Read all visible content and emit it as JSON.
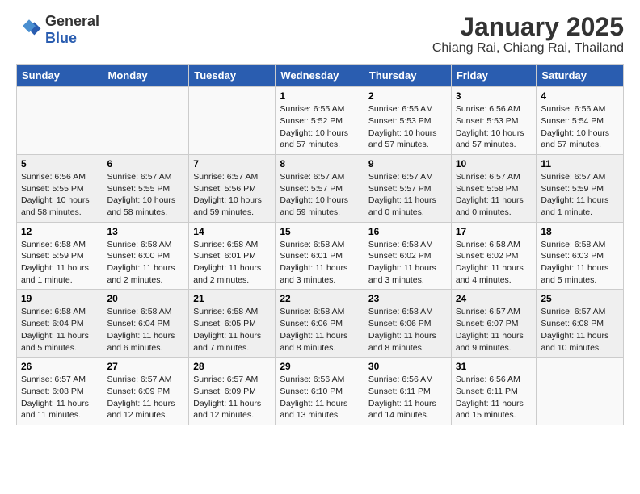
{
  "header": {
    "logo_general": "General",
    "logo_blue": "Blue",
    "title": "January 2025",
    "subtitle": "Chiang Rai, Chiang Rai, Thailand"
  },
  "weekdays": [
    "Sunday",
    "Monday",
    "Tuesday",
    "Wednesday",
    "Thursday",
    "Friday",
    "Saturday"
  ],
  "weeks": [
    [
      {
        "day": "",
        "info": ""
      },
      {
        "day": "",
        "info": ""
      },
      {
        "day": "",
        "info": ""
      },
      {
        "day": "1",
        "info": "Sunrise: 6:55 AM\nSunset: 5:52 PM\nDaylight: 10 hours\nand 57 minutes."
      },
      {
        "day": "2",
        "info": "Sunrise: 6:55 AM\nSunset: 5:53 PM\nDaylight: 10 hours\nand 57 minutes."
      },
      {
        "day": "3",
        "info": "Sunrise: 6:56 AM\nSunset: 5:53 PM\nDaylight: 10 hours\nand 57 minutes."
      },
      {
        "day": "4",
        "info": "Sunrise: 6:56 AM\nSunset: 5:54 PM\nDaylight: 10 hours\nand 57 minutes."
      }
    ],
    [
      {
        "day": "5",
        "info": "Sunrise: 6:56 AM\nSunset: 5:55 PM\nDaylight: 10 hours\nand 58 minutes."
      },
      {
        "day": "6",
        "info": "Sunrise: 6:57 AM\nSunset: 5:55 PM\nDaylight: 10 hours\nand 58 minutes."
      },
      {
        "day": "7",
        "info": "Sunrise: 6:57 AM\nSunset: 5:56 PM\nDaylight: 10 hours\nand 59 minutes."
      },
      {
        "day": "8",
        "info": "Sunrise: 6:57 AM\nSunset: 5:57 PM\nDaylight: 10 hours\nand 59 minutes."
      },
      {
        "day": "9",
        "info": "Sunrise: 6:57 AM\nSunset: 5:57 PM\nDaylight: 11 hours\nand 0 minutes."
      },
      {
        "day": "10",
        "info": "Sunrise: 6:57 AM\nSunset: 5:58 PM\nDaylight: 11 hours\nand 0 minutes."
      },
      {
        "day": "11",
        "info": "Sunrise: 6:57 AM\nSunset: 5:59 PM\nDaylight: 11 hours\nand 1 minute."
      }
    ],
    [
      {
        "day": "12",
        "info": "Sunrise: 6:58 AM\nSunset: 5:59 PM\nDaylight: 11 hours\nand 1 minute."
      },
      {
        "day": "13",
        "info": "Sunrise: 6:58 AM\nSunset: 6:00 PM\nDaylight: 11 hours\nand 2 minutes."
      },
      {
        "day": "14",
        "info": "Sunrise: 6:58 AM\nSunset: 6:01 PM\nDaylight: 11 hours\nand 2 minutes."
      },
      {
        "day": "15",
        "info": "Sunrise: 6:58 AM\nSunset: 6:01 PM\nDaylight: 11 hours\nand 3 minutes."
      },
      {
        "day": "16",
        "info": "Sunrise: 6:58 AM\nSunset: 6:02 PM\nDaylight: 11 hours\nand 3 minutes."
      },
      {
        "day": "17",
        "info": "Sunrise: 6:58 AM\nSunset: 6:02 PM\nDaylight: 11 hours\nand 4 minutes."
      },
      {
        "day": "18",
        "info": "Sunrise: 6:58 AM\nSunset: 6:03 PM\nDaylight: 11 hours\nand 5 minutes."
      }
    ],
    [
      {
        "day": "19",
        "info": "Sunrise: 6:58 AM\nSunset: 6:04 PM\nDaylight: 11 hours\nand 5 minutes."
      },
      {
        "day": "20",
        "info": "Sunrise: 6:58 AM\nSunset: 6:04 PM\nDaylight: 11 hours\nand 6 minutes."
      },
      {
        "day": "21",
        "info": "Sunrise: 6:58 AM\nSunset: 6:05 PM\nDaylight: 11 hours\nand 7 minutes."
      },
      {
        "day": "22",
        "info": "Sunrise: 6:58 AM\nSunset: 6:06 PM\nDaylight: 11 hours\nand 8 minutes."
      },
      {
        "day": "23",
        "info": "Sunrise: 6:58 AM\nSunset: 6:06 PM\nDaylight: 11 hours\nand 8 minutes."
      },
      {
        "day": "24",
        "info": "Sunrise: 6:57 AM\nSunset: 6:07 PM\nDaylight: 11 hours\nand 9 minutes."
      },
      {
        "day": "25",
        "info": "Sunrise: 6:57 AM\nSunset: 6:08 PM\nDaylight: 11 hours\nand 10 minutes."
      }
    ],
    [
      {
        "day": "26",
        "info": "Sunrise: 6:57 AM\nSunset: 6:08 PM\nDaylight: 11 hours\nand 11 minutes."
      },
      {
        "day": "27",
        "info": "Sunrise: 6:57 AM\nSunset: 6:09 PM\nDaylight: 11 hours\nand 12 minutes."
      },
      {
        "day": "28",
        "info": "Sunrise: 6:57 AM\nSunset: 6:09 PM\nDaylight: 11 hours\nand 12 minutes."
      },
      {
        "day": "29",
        "info": "Sunrise: 6:56 AM\nSunset: 6:10 PM\nDaylight: 11 hours\nand 13 minutes."
      },
      {
        "day": "30",
        "info": "Sunrise: 6:56 AM\nSunset: 6:11 PM\nDaylight: 11 hours\nand 14 minutes."
      },
      {
        "day": "31",
        "info": "Sunrise: 6:56 AM\nSunset: 6:11 PM\nDaylight: 11 hours\nand 15 minutes."
      },
      {
        "day": "",
        "info": ""
      }
    ]
  ]
}
